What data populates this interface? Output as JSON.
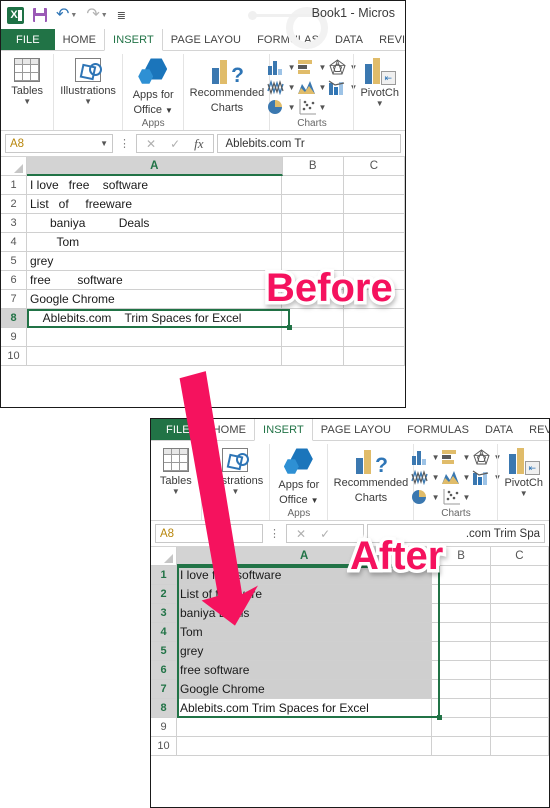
{
  "window": {
    "title": "Book1 - Micros",
    "quick_access": {
      "excel_logo": "excel-logo",
      "save": "Save",
      "undo": "Undo",
      "redo": "Redo",
      "customize": "Customize Quick Access Toolbar"
    }
  },
  "ribbon": {
    "tabs": [
      {
        "label": "FILE",
        "active": false,
        "file": true
      },
      {
        "label": "HOME",
        "active": false
      },
      {
        "label": "INSERT",
        "active": true
      },
      {
        "label": "PAGE LAYOU",
        "active": false
      },
      {
        "label": "FORMULAS",
        "active": false
      },
      {
        "label": "DATA",
        "active": false
      },
      {
        "label": "REVIEW",
        "active": false
      }
    ],
    "groups": {
      "tables": {
        "label": "Tables"
      },
      "illustrations": {
        "label": "Illustrations"
      },
      "apps_for_office": {
        "line1": "Apps for",
        "line2": "Office",
        "group_label": "Apps"
      },
      "recommended_charts": {
        "line1": "Recommended",
        "line2": "Charts"
      },
      "charts_group_label": "Charts",
      "chart_icons": [
        "column-chart-icon",
        "bar-chart-icon",
        "radar-chart-icon",
        "line-chart-icon",
        "area-chart-icon",
        "combo-chart-icon",
        "pie-chart-icon",
        "scatter-chart-icon"
      ],
      "pivotchart": {
        "label": "PivotCh"
      }
    }
  },
  "before": {
    "namebox": "A8",
    "formula_bar": "Ablebits.com   Tr",
    "columns": [
      "A",
      "B",
      "C"
    ],
    "selected_column": "A",
    "active_row": 8,
    "rows": [
      {
        "n": "1",
        "a": "I love   free    software"
      },
      {
        "n": "2",
        "a": "List   of     freeware"
      },
      {
        "n": "3",
        "a": "      baniya          Deals"
      },
      {
        "n": "4",
        "a": "        Tom"
      },
      {
        "n": "5",
        "a": "grey"
      },
      {
        "n": "6",
        "a": "free        software"
      },
      {
        "n": "7",
        "a": "Google Chrome"
      },
      {
        "n": "8",
        "a": "    Ablebits.com    Trim Spaces for Excel"
      },
      {
        "n": "9",
        "a": ""
      },
      {
        "n": "10",
        "a": ""
      }
    ],
    "badge": "Before"
  },
  "after": {
    "namebox": "A8",
    "formula_bar": ".com Trim Spa",
    "columns": [
      "A",
      "B",
      "C"
    ],
    "selected_column": "A",
    "active_row": 8,
    "selection_range": "A1:A8",
    "rows": [
      {
        "n": "1",
        "a": "I love free software",
        "sel": true
      },
      {
        "n": "2",
        "a": "List of freeware",
        "sel": true
      },
      {
        "n": "3",
        "a": "baniya Deals",
        "sel": true
      },
      {
        "n": "4",
        "a": "Tom",
        "sel": true
      },
      {
        "n": "5",
        "a": "grey",
        "sel": true
      },
      {
        "n": "6",
        "a": "free software",
        "sel": true
      },
      {
        "n": "7",
        "a": "Google Chrome",
        "sel": true
      },
      {
        "n": "8",
        "a": "Ablebits.com Trim Spaces for Excel",
        "sel": false
      },
      {
        "n": "9",
        "a": "",
        "sel": false
      },
      {
        "n": "10",
        "a": "",
        "sel": false
      }
    ],
    "badge": "After"
  },
  "annotation": {
    "arrow": "down-right-arrow",
    "arrow_color": "#f5125e"
  },
  "colors": {
    "accent_pink": "#f5125e",
    "excel_green": "#217346",
    "tab_active_text": "#217346",
    "selection_fill": "#cfcfcf",
    "chart_blue": "#3b78b0",
    "chart_gold": "#e0bc6a"
  }
}
